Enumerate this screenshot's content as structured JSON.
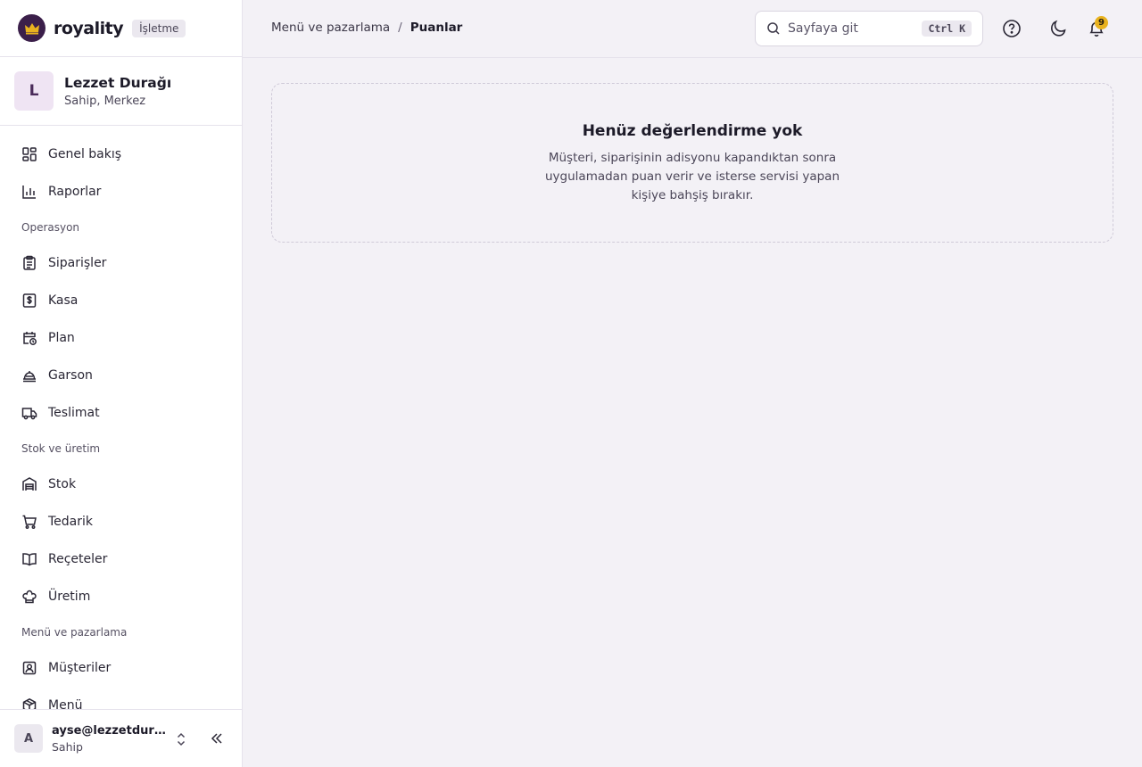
{
  "brand": {
    "name": "royality",
    "tag": "İşletme",
    "color": "#3b1f4a"
  },
  "org": {
    "initial": "L",
    "name": "Lezzet Durağı",
    "role": "Sahip, Merkez"
  },
  "nav": {
    "top": [
      {
        "label": "Genel bakış",
        "icon": "grid-icon"
      },
      {
        "label": "Raporlar",
        "icon": "bar-chart-icon"
      }
    ],
    "sections": [
      {
        "title": "Operasyon",
        "items": [
          {
            "label": "Siparişler",
            "icon": "clipboard-icon"
          },
          {
            "label": "Kasa",
            "icon": "cash-register-icon"
          },
          {
            "label": "Plan",
            "icon": "calendar-clock-icon"
          },
          {
            "label": "Garson",
            "icon": "cloche-icon"
          },
          {
            "label": "Teslimat",
            "icon": "truck-icon"
          }
        ]
      },
      {
        "title": "Stok ve üretim",
        "items": [
          {
            "label": "Stok",
            "icon": "warehouse-icon"
          },
          {
            "label": "Tedarik",
            "icon": "cart-icon"
          },
          {
            "label": "Reçeteler",
            "icon": "book-open-icon"
          },
          {
            "label": "Üretim",
            "icon": "chef-hat-icon"
          }
        ]
      },
      {
        "title": "Menü ve pazarlama",
        "items": [
          {
            "label": "Müşteriler",
            "icon": "contact-icon"
          },
          {
            "label": "Menü",
            "icon": "package-icon"
          }
        ]
      }
    ]
  },
  "user": {
    "initial": "A",
    "email": "ayse@lezzetdurağı.com",
    "role": "Sahip"
  },
  "header": {
    "breadcrumb_parent": "Menü ve pazarlama",
    "breadcrumb_sep": "/",
    "breadcrumb_current": "Puanlar",
    "search_placeholder": "Sayfaya git",
    "search_shortcut": "Ctrl K",
    "notification_count": "9"
  },
  "empty_state": {
    "title": "Henüz değerlendirme yok",
    "description": "Müşteri, siparişinin adisyonu kapandıktan sonra uygulamadan puan verir ve isterse servisi yapan kişiye bahşiş bırakır."
  }
}
